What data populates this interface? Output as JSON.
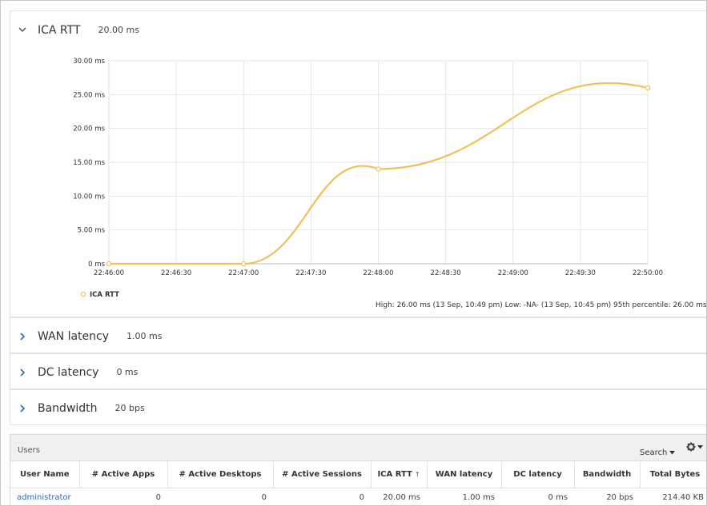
{
  "ica_panel": {
    "title": "ICA RTT",
    "value": "20.00 ms",
    "summary": "High: 26.00 ms  (13 Sep, 10:49 pm)  Low: -NA-  (13 Sep, 10:45 pm)  95th percentile: 26.00 ms"
  },
  "chart_data": {
    "type": "line",
    "title": "",
    "xlabel": "",
    "ylabel": "",
    "x_ticks": [
      "22:46:00",
      "22:46:30",
      "22:47:00",
      "22:47:30",
      "22:48:00",
      "22:48:30",
      "22:49:00",
      "22:49:30",
      "22:50:00"
    ],
    "y_ticks": [
      "0 ms",
      "5.00 ms",
      "10.00 ms",
      "15.00 ms",
      "20.00 ms",
      "25.00 ms",
      "30.00 ms"
    ],
    "ylim": [
      0,
      30
    ],
    "grid": true,
    "legend_position": "bottom-left",
    "series": [
      {
        "name": "ICA RTT",
        "color": "#f0c15a",
        "points": [
          {
            "x": "22:46:00",
            "y": 0
          },
          {
            "x": "22:47:00",
            "y": 0
          },
          {
            "x": "22:48:00",
            "y": 14
          },
          {
            "x": "22:50:00",
            "y": 26
          }
        ]
      }
    ]
  },
  "collapsed_panels": [
    {
      "title": "WAN latency",
      "value": "1.00 ms"
    },
    {
      "title": "DC latency",
      "value": "0 ms"
    },
    {
      "title": "Bandwidth",
      "value": "20 bps"
    }
  ],
  "users_table": {
    "title": "Users",
    "search_label": "Search",
    "columns": [
      "User Name",
      "# Active Apps",
      "# Active Desktops",
      "# Active Sessions",
      "ICA RTT",
      "WAN latency",
      "DC latency",
      "Bandwidth",
      "Total Bytes"
    ],
    "rows": [
      [
        "administrator",
        "0",
        "0",
        "0",
        "20.00 ms",
        "1.00 ms",
        "0 ms",
        "20 bps",
        "214.40 KB"
      ]
    ]
  },
  "colors": {
    "line": "#f0c15a",
    "grid": "#e6e6e6",
    "link": "#2a6bb5",
    "chevron": "#2a6bb5"
  }
}
